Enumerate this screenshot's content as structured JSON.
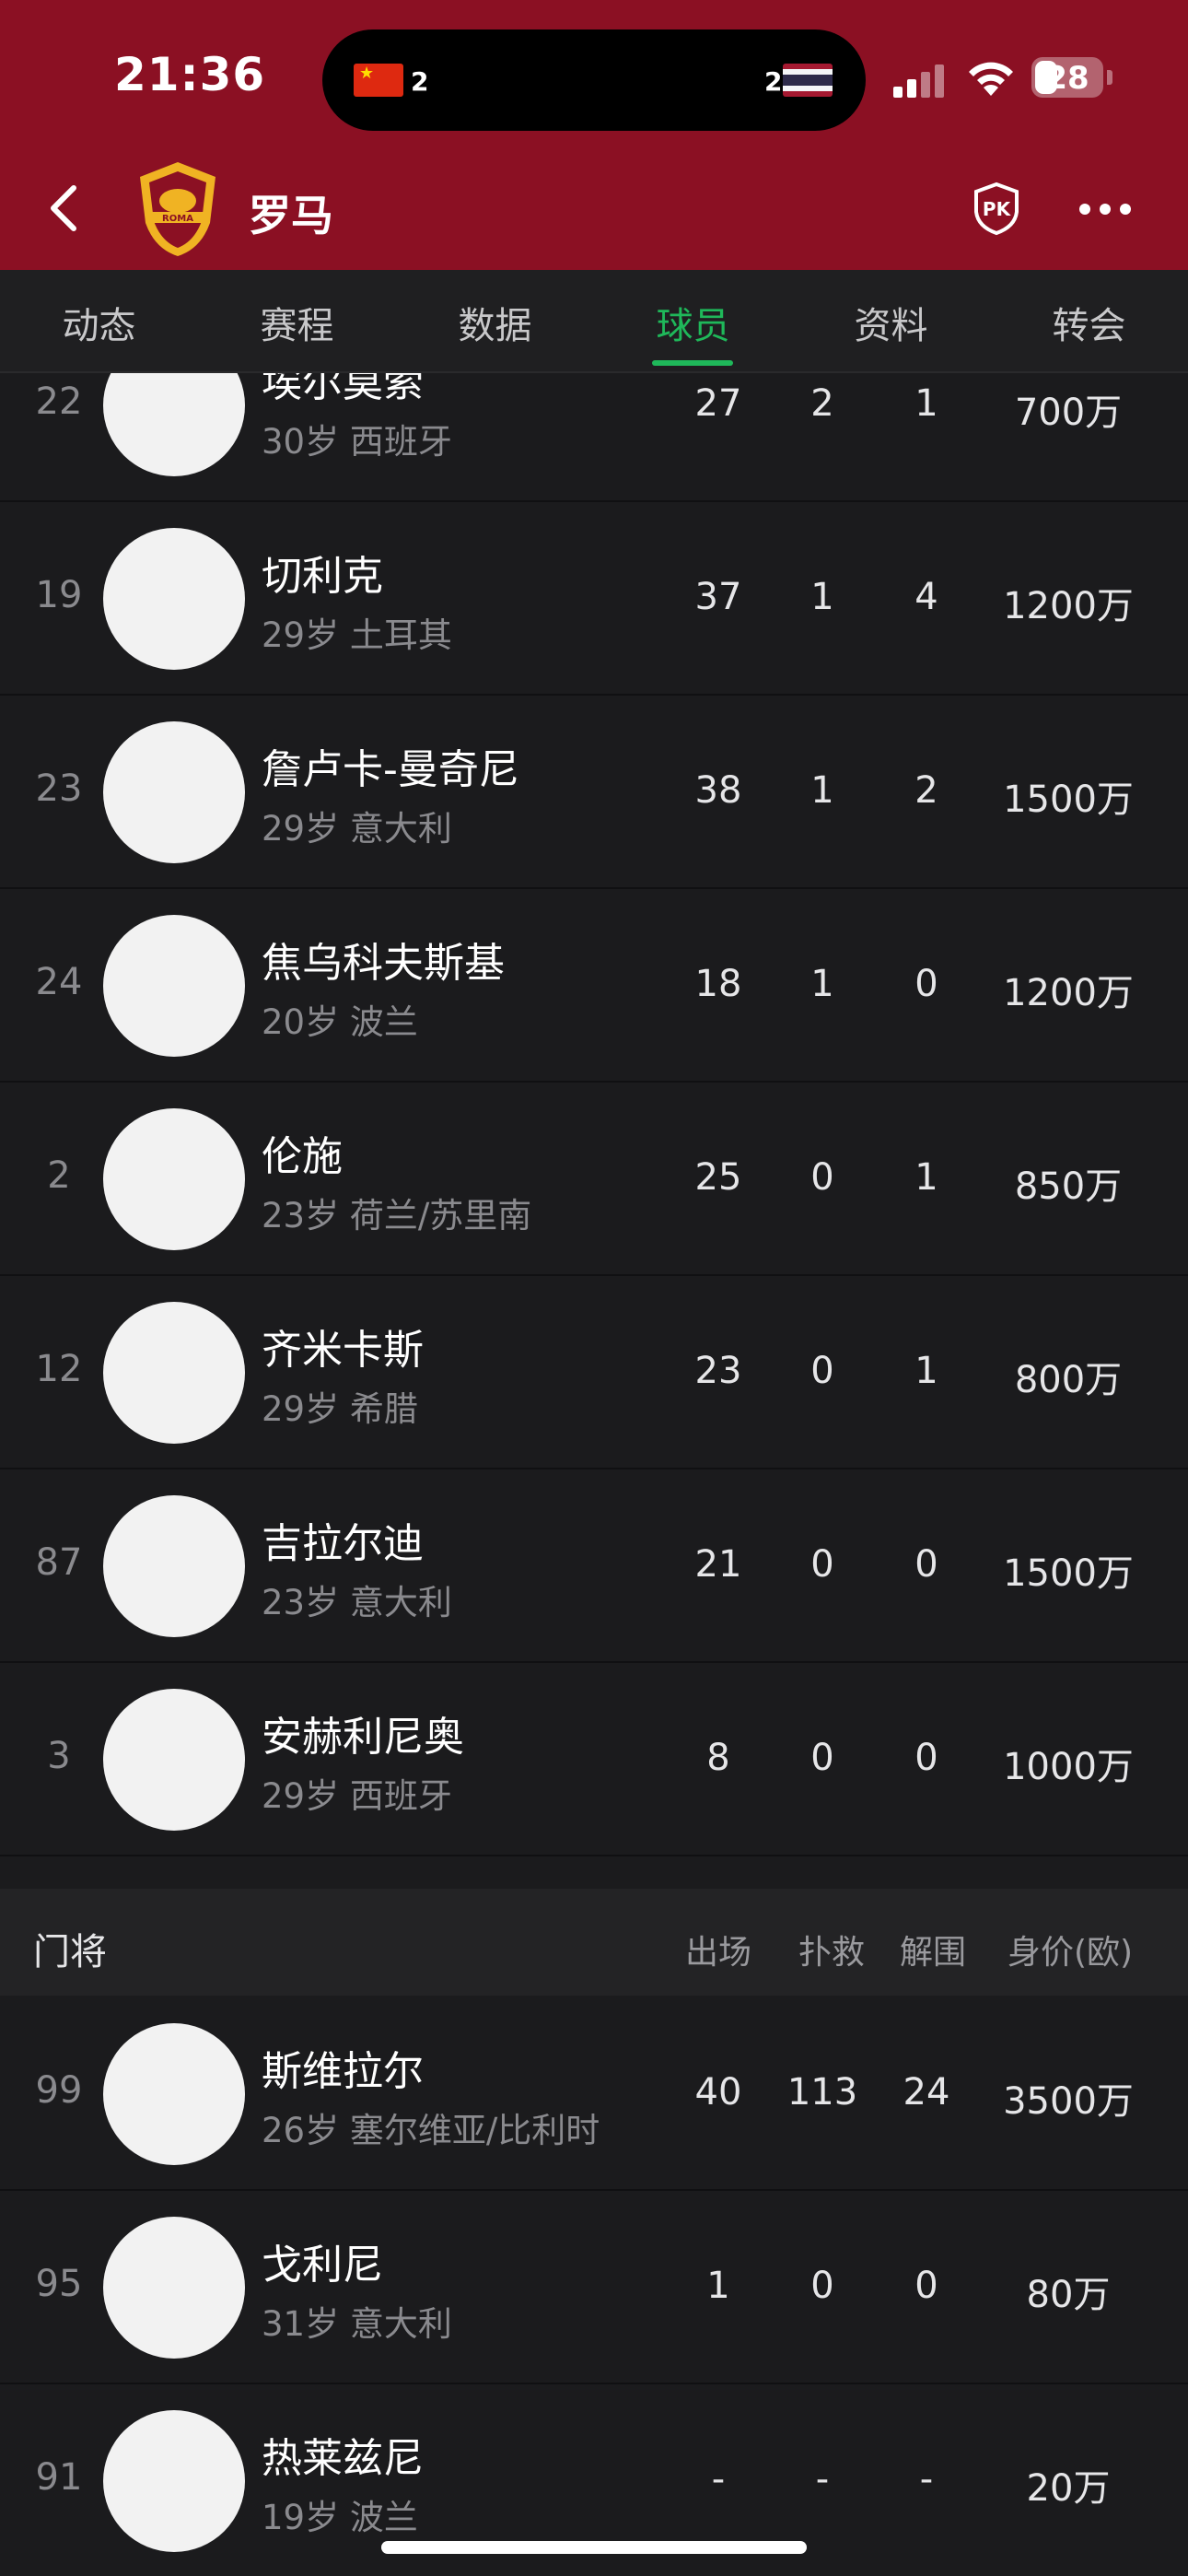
{
  "status_bar": {
    "time": "21:36",
    "live_match": {
      "home_score": "2",
      "away_score": "2"
    },
    "battery": "28"
  },
  "nav": {
    "team_name": "罗马"
  },
  "tabs": [
    {
      "label": "动态"
    },
    {
      "label": "赛程"
    },
    {
      "label": "数据"
    },
    {
      "label": "球员",
      "active": true
    },
    {
      "label": "资料"
    },
    {
      "label": "转会"
    }
  ],
  "players_top": [
    {
      "number": "22",
      "name": "埃尔莫索",
      "meta": "30岁 西班牙",
      "s1": "27",
      "s2": "2",
      "s3": "1",
      "value": "700万"
    },
    {
      "number": "19",
      "name": "切利克",
      "meta": "29岁 土耳其",
      "s1": "37",
      "s2": "1",
      "s3": "4",
      "value": "1200万"
    },
    {
      "number": "23",
      "name": "詹卢卡-曼奇尼",
      "meta": "29岁 意大利",
      "s1": "38",
      "s2": "1",
      "s3": "2",
      "value": "1500万"
    },
    {
      "number": "24",
      "name": "焦乌科夫斯基",
      "meta": "20岁 波兰",
      "s1": "18",
      "s2": "1",
      "s3": "0",
      "value": "1200万"
    },
    {
      "number": "2",
      "name": "伦施",
      "meta": "23岁 荷兰/苏里南",
      "s1": "25",
      "s2": "0",
      "s3": "1",
      "value": "850万"
    },
    {
      "number": "12",
      "name": "齐米卡斯",
      "meta": "29岁 希腊",
      "s1": "23",
      "s2": "0",
      "s3": "1",
      "value": "800万"
    },
    {
      "number": "87",
      "name": "吉拉尔迪",
      "meta": "23岁 意大利",
      "s1": "21",
      "s2": "0",
      "s3": "0",
      "value": "1500万"
    },
    {
      "number": "3",
      "name": "安赫利尼奥",
      "meta": "29岁 西班牙",
      "s1": "8",
      "s2": "0",
      "s3": "0",
      "value": "1000万"
    }
  ],
  "goalkeeper_section": {
    "title": "门将",
    "columns": [
      "出场",
      "扑救",
      "解围",
      "身价(欧)"
    ]
  },
  "goalkeepers": [
    {
      "number": "99",
      "name": "斯维拉尔",
      "meta": "26岁 塞尔维亚/比利时",
      "s1": "40",
      "s2": "113",
      "s3": "24",
      "value": "3500万"
    },
    {
      "number": "95",
      "name": "戈利尼",
      "meta": "31岁 意大利",
      "s1": "1",
      "s2": "0",
      "s3": "0",
      "value": "80万"
    },
    {
      "number": "91",
      "name": "热莱兹尼",
      "meta": "19岁 波兰",
      "s1": "-",
      "s2": "-",
      "s3": "-",
      "value": "20万"
    }
  ],
  "colors": {
    "header_bg": "#8b1023",
    "accent": "#1fb85a",
    "page_bg": "#1b1b1d"
  }
}
